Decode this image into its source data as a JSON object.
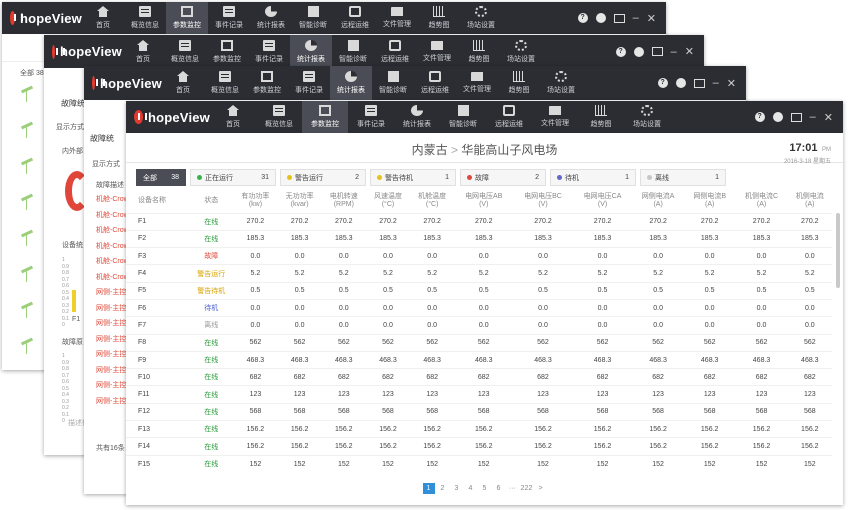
{
  "app": {
    "brand": "hopeView"
  },
  "nav": [
    "首页",
    "概览信息",
    "参数监控",
    "事件记录",
    "统计报表",
    "智能诊断",
    "远程运维",
    "文件管理",
    "趋势图",
    "场站设置"
  ],
  "bg_windows": {
    "w1_total": "全部 38",
    "w3": {
      "title": "故障统",
      "filter_label": "显示方式",
      "items": [
        "内外部",
        "设备统",
        "故障原"
      ],
      "y_ticks": [
        "1",
        "0.9",
        "0.8",
        "0.7",
        "0.6",
        "0.5",
        "0.4",
        "0.3",
        "0.2",
        "0.1",
        "0"
      ],
      "x_tick": "F1",
      "caption": "描述信"
    },
    "w2": {
      "title": "故障统",
      "filter_label": "显示方式",
      "col": "故障描述",
      "rows": [
        "机舱-Crow",
        "机舱-Crow",
        "机舱-Crow",
        "机舱-Crow",
        "机舱-Crow",
        "机舱-Crow",
        "网侧-主控",
        "网侧-主控",
        "网侧-主控",
        "网侧-主控",
        "网侧-主控",
        "网侧-主控",
        "网侧-主控",
        "网侧-主控"
      ],
      "footer": "共有16条"
    }
  },
  "main": {
    "breadcrumb": {
      "region": "内蒙古",
      "sep": ">",
      "site": "华能高山子风电场"
    },
    "clock": {
      "time": "17:01",
      "ampm": "PM",
      "date": "2016-3-18 星期五"
    },
    "status": [
      {
        "label": "全部",
        "count": "38",
        "color": ""
      },
      {
        "label": "正在运行",
        "count": "31",
        "color": "#3cb34a"
      },
      {
        "label": "警告运行",
        "count": "2",
        "color": "#e5c21a"
      },
      {
        "label": "警告待机",
        "count": "1",
        "color": "#e5c21a"
      },
      {
        "label": "故障",
        "count": "2",
        "color": "#e0473a"
      },
      {
        "label": "待机",
        "count": "1",
        "color": "#6666cc"
      },
      {
        "label": "离线",
        "count": "1",
        "color": "#c8c8c8"
      }
    ],
    "columns": [
      [
        "设备名称",
        ""
      ],
      [
        "状态",
        ""
      ],
      [
        "有功功率",
        "(kw)"
      ],
      [
        "无功功率",
        "(kvar)"
      ],
      [
        "电机转速",
        "(RPM)"
      ],
      [
        "风速温度",
        "(°C)"
      ],
      [
        "机舱温度",
        "(°C)"
      ],
      [
        "电网电压AB",
        "(V)"
      ],
      [
        "电网电压BC",
        "(V)"
      ],
      [
        "电网电压CA",
        "(V)"
      ],
      [
        "网侧电流A",
        "(A)"
      ],
      [
        "网侧电流B",
        "(A)"
      ],
      [
        "机侧电流C",
        "(A)"
      ],
      [
        "机侧电流",
        "(A)"
      ]
    ],
    "rows": [
      {
        "id": "F1",
        "status": "在线",
        "sc": "#2a9d3a",
        "v": "270.2"
      },
      {
        "id": "F2",
        "status": "在线",
        "sc": "#2a9d3a",
        "v": "185.3"
      },
      {
        "id": "F3",
        "status": "故障",
        "sc": "#e0473a",
        "v": "0.0"
      },
      {
        "id": "F4",
        "status": "警告运行",
        "sc": "#d9a400",
        "v": "5.2"
      },
      {
        "id": "F5",
        "status": "警告待机",
        "sc": "#d9a400",
        "v": "0.5"
      },
      {
        "id": "F6",
        "status": "待机",
        "sc": "#4a5fd0",
        "v": "0.0"
      },
      {
        "id": "F7",
        "status": "离线",
        "sc": "#999999",
        "v": "0.0"
      },
      {
        "id": "F8",
        "status": "在线",
        "sc": "#2a9d3a",
        "v": "562"
      },
      {
        "id": "F9",
        "status": "在线",
        "sc": "#2a9d3a",
        "v": "468.3"
      },
      {
        "id": "F10",
        "status": "在线",
        "sc": "#2a9d3a",
        "v": "682"
      },
      {
        "id": "F11",
        "status": "在线",
        "sc": "#2a9d3a",
        "v": "123"
      },
      {
        "id": "F12",
        "status": "在线",
        "sc": "#2a9d3a",
        "v": "568"
      },
      {
        "id": "F13",
        "status": "在线",
        "sc": "#2a9d3a",
        "v": "156.2"
      },
      {
        "id": "F14",
        "status": "在线",
        "sc": "#2a9d3a",
        "v": "156.2"
      },
      {
        "id": "F15",
        "status": "在线",
        "sc": "#2a9d3a",
        "v": "152"
      }
    ],
    "pagination": [
      "1",
      "2",
      "3",
      "4",
      "5",
      "6",
      "···",
      "222",
      ">"
    ]
  }
}
